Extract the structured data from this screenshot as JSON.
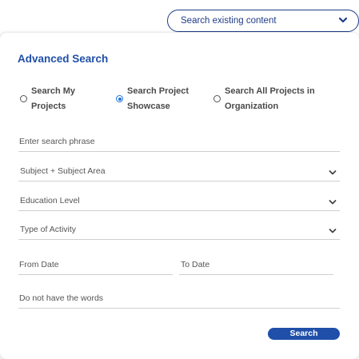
{
  "top_bar": {
    "label": "Search existing content",
    "icon": "chevron-down-icon"
  },
  "panel": {
    "title": "Advanced Search",
    "radios": [
      {
        "line1": "Search My",
        "line2": "Projects",
        "checked": false
      },
      {
        "line1": "Search Project",
        "line2": "Showcase",
        "checked": true
      },
      {
        "line1": "Search All Projects in",
        "line2": "Organization",
        "checked": false
      }
    ],
    "fields": {
      "phrase_placeholder": "Enter search phrase",
      "subject": "Subject + Subject Area",
      "education_level": "Education Level",
      "activity_type": "Type of Activity",
      "from_date": "From Date",
      "to_date": "To Date",
      "exclude_words": "Do not have the words"
    },
    "search_button": "Search"
  },
  "colors": {
    "accent": "#1f4fa8",
    "pill_border": "#1f3c88",
    "radio_checked": "#1f73e0"
  }
}
